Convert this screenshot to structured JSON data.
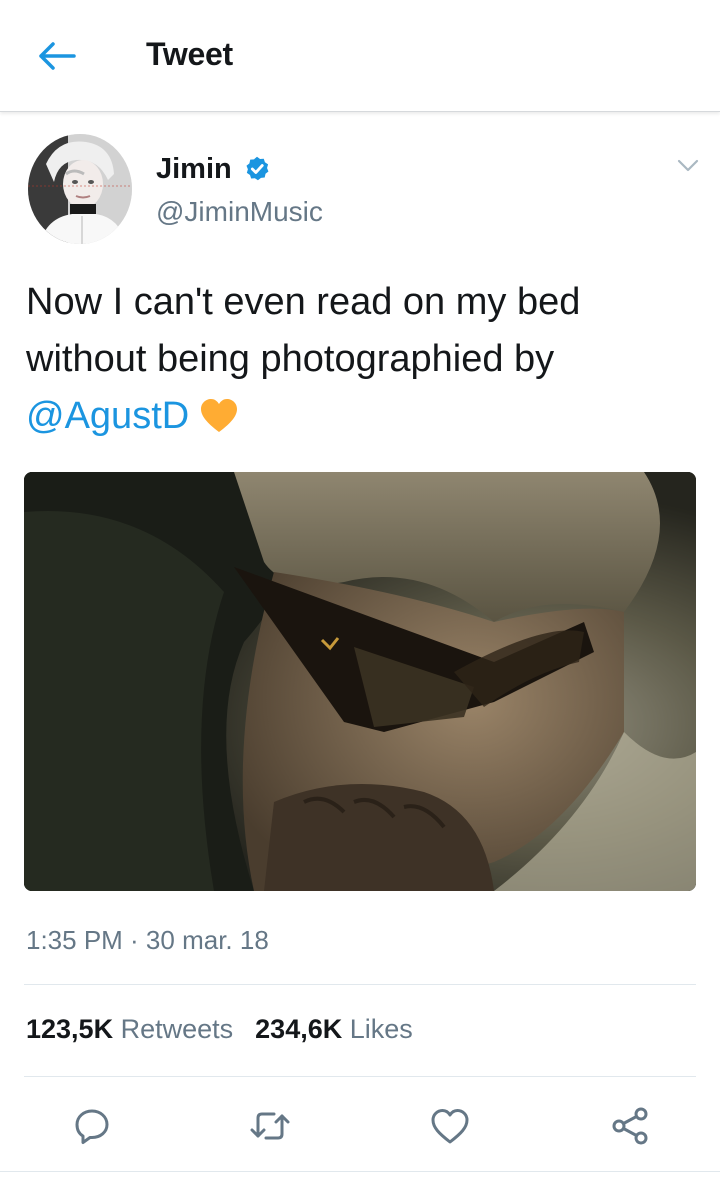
{
  "header": {
    "title": "Tweet",
    "back_icon": "arrow-left-icon"
  },
  "tweet": {
    "user": {
      "name": "Jimin",
      "handle": "@JiminMusic",
      "verified": true,
      "verified_icon": "verified-badge-icon"
    },
    "text_lines": [
      "Now I can't even read on my bed",
      "without being photographied by"
    ],
    "mention": "@AgustD",
    "emoji": "yellow-heart-icon",
    "timestamp": "1:35 PM · 30 mar. 18",
    "stats": {
      "retweets_count": "123,5K",
      "retweets_label": "Retweets",
      "likes_count": "234,6K",
      "likes_label": "Likes"
    },
    "actions": [
      "reply-icon",
      "retweet-icon",
      "like-icon",
      "share-icon"
    ]
  },
  "colors": {
    "accent": "#1b95e0",
    "text": "#14171a",
    "secondary_text": "#657786",
    "heart": "#ffac33"
  }
}
